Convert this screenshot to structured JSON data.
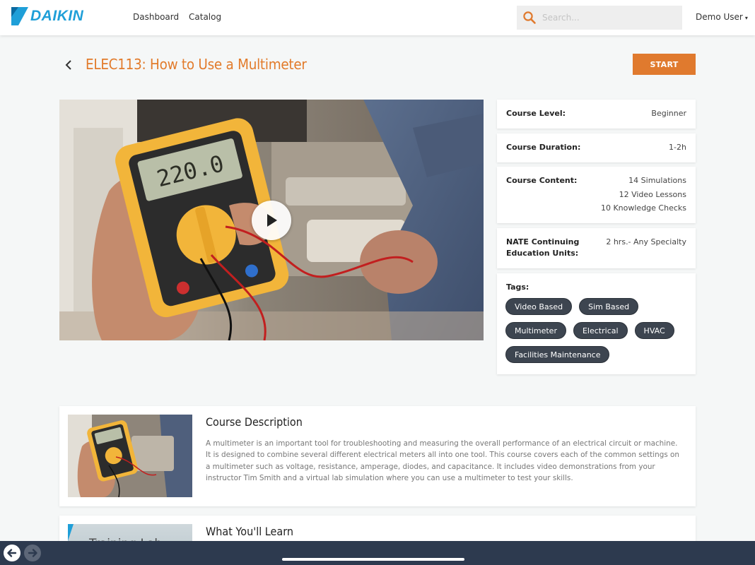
{
  "header": {
    "logo_text": "DAIKIN",
    "nav": [
      {
        "label": "Dashboard"
      },
      {
        "label": "Catalog"
      }
    ],
    "search_placeholder": "Search...",
    "user_label": "Demo User",
    "user_caret": "▾"
  },
  "course": {
    "title": "ELEC113: How to Use a Multimeter",
    "start_label": "START"
  },
  "info": {
    "level_label": "Course Level:",
    "level_value": "Beginner",
    "duration_label": "Course Duration:",
    "duration_value": "1-2h",
    "content_label": "Course Content:",
    "content_values": [
      "14 Simulations",
      "12 Video Lessons",
      "10 Knowledge Checks"
    ],
    "nate_label_1": "NATE Continuing",
    "nate_label_2": "Education Units:",
    "nate_value": "2 hrs.- Any Specialty",
    "tags_label": "Tags:",
    "tags": [
      "Video Based",
      "Sim Based",
      "Multimeter",
      "Electrical",
      "HVAC",
      "Facilities Maintenance"
    ]
  },
  "description": {
    "title": "Course Description",
    "text": "A multimeter is an important tool for troubleshooting and measuring the overall performance of an electrical circuit or machine. It is designed to combine several different electrical meters all into one tool. This course covers each of the common settings on a multimeter such as voltage, resistance, amperage, diodes, and capacitance. It includes video demonstrations from your instructor Tim Smith and a virtual lab simulation where you can use a multimeter to test your skills."
  },
  "learn": {
    "title": "What You'll Learn",
    "thumb_text": "Training Lab"
  },
  "video": {
    "display_reading": "220.0"
  },
  "colors": {
    "accent": "#e07a2e",
    "brand": "#1f9fd8",
    "tag_bg": "#3d4550",
    "bottom_bar": "#2d3a4f"
  }
}
